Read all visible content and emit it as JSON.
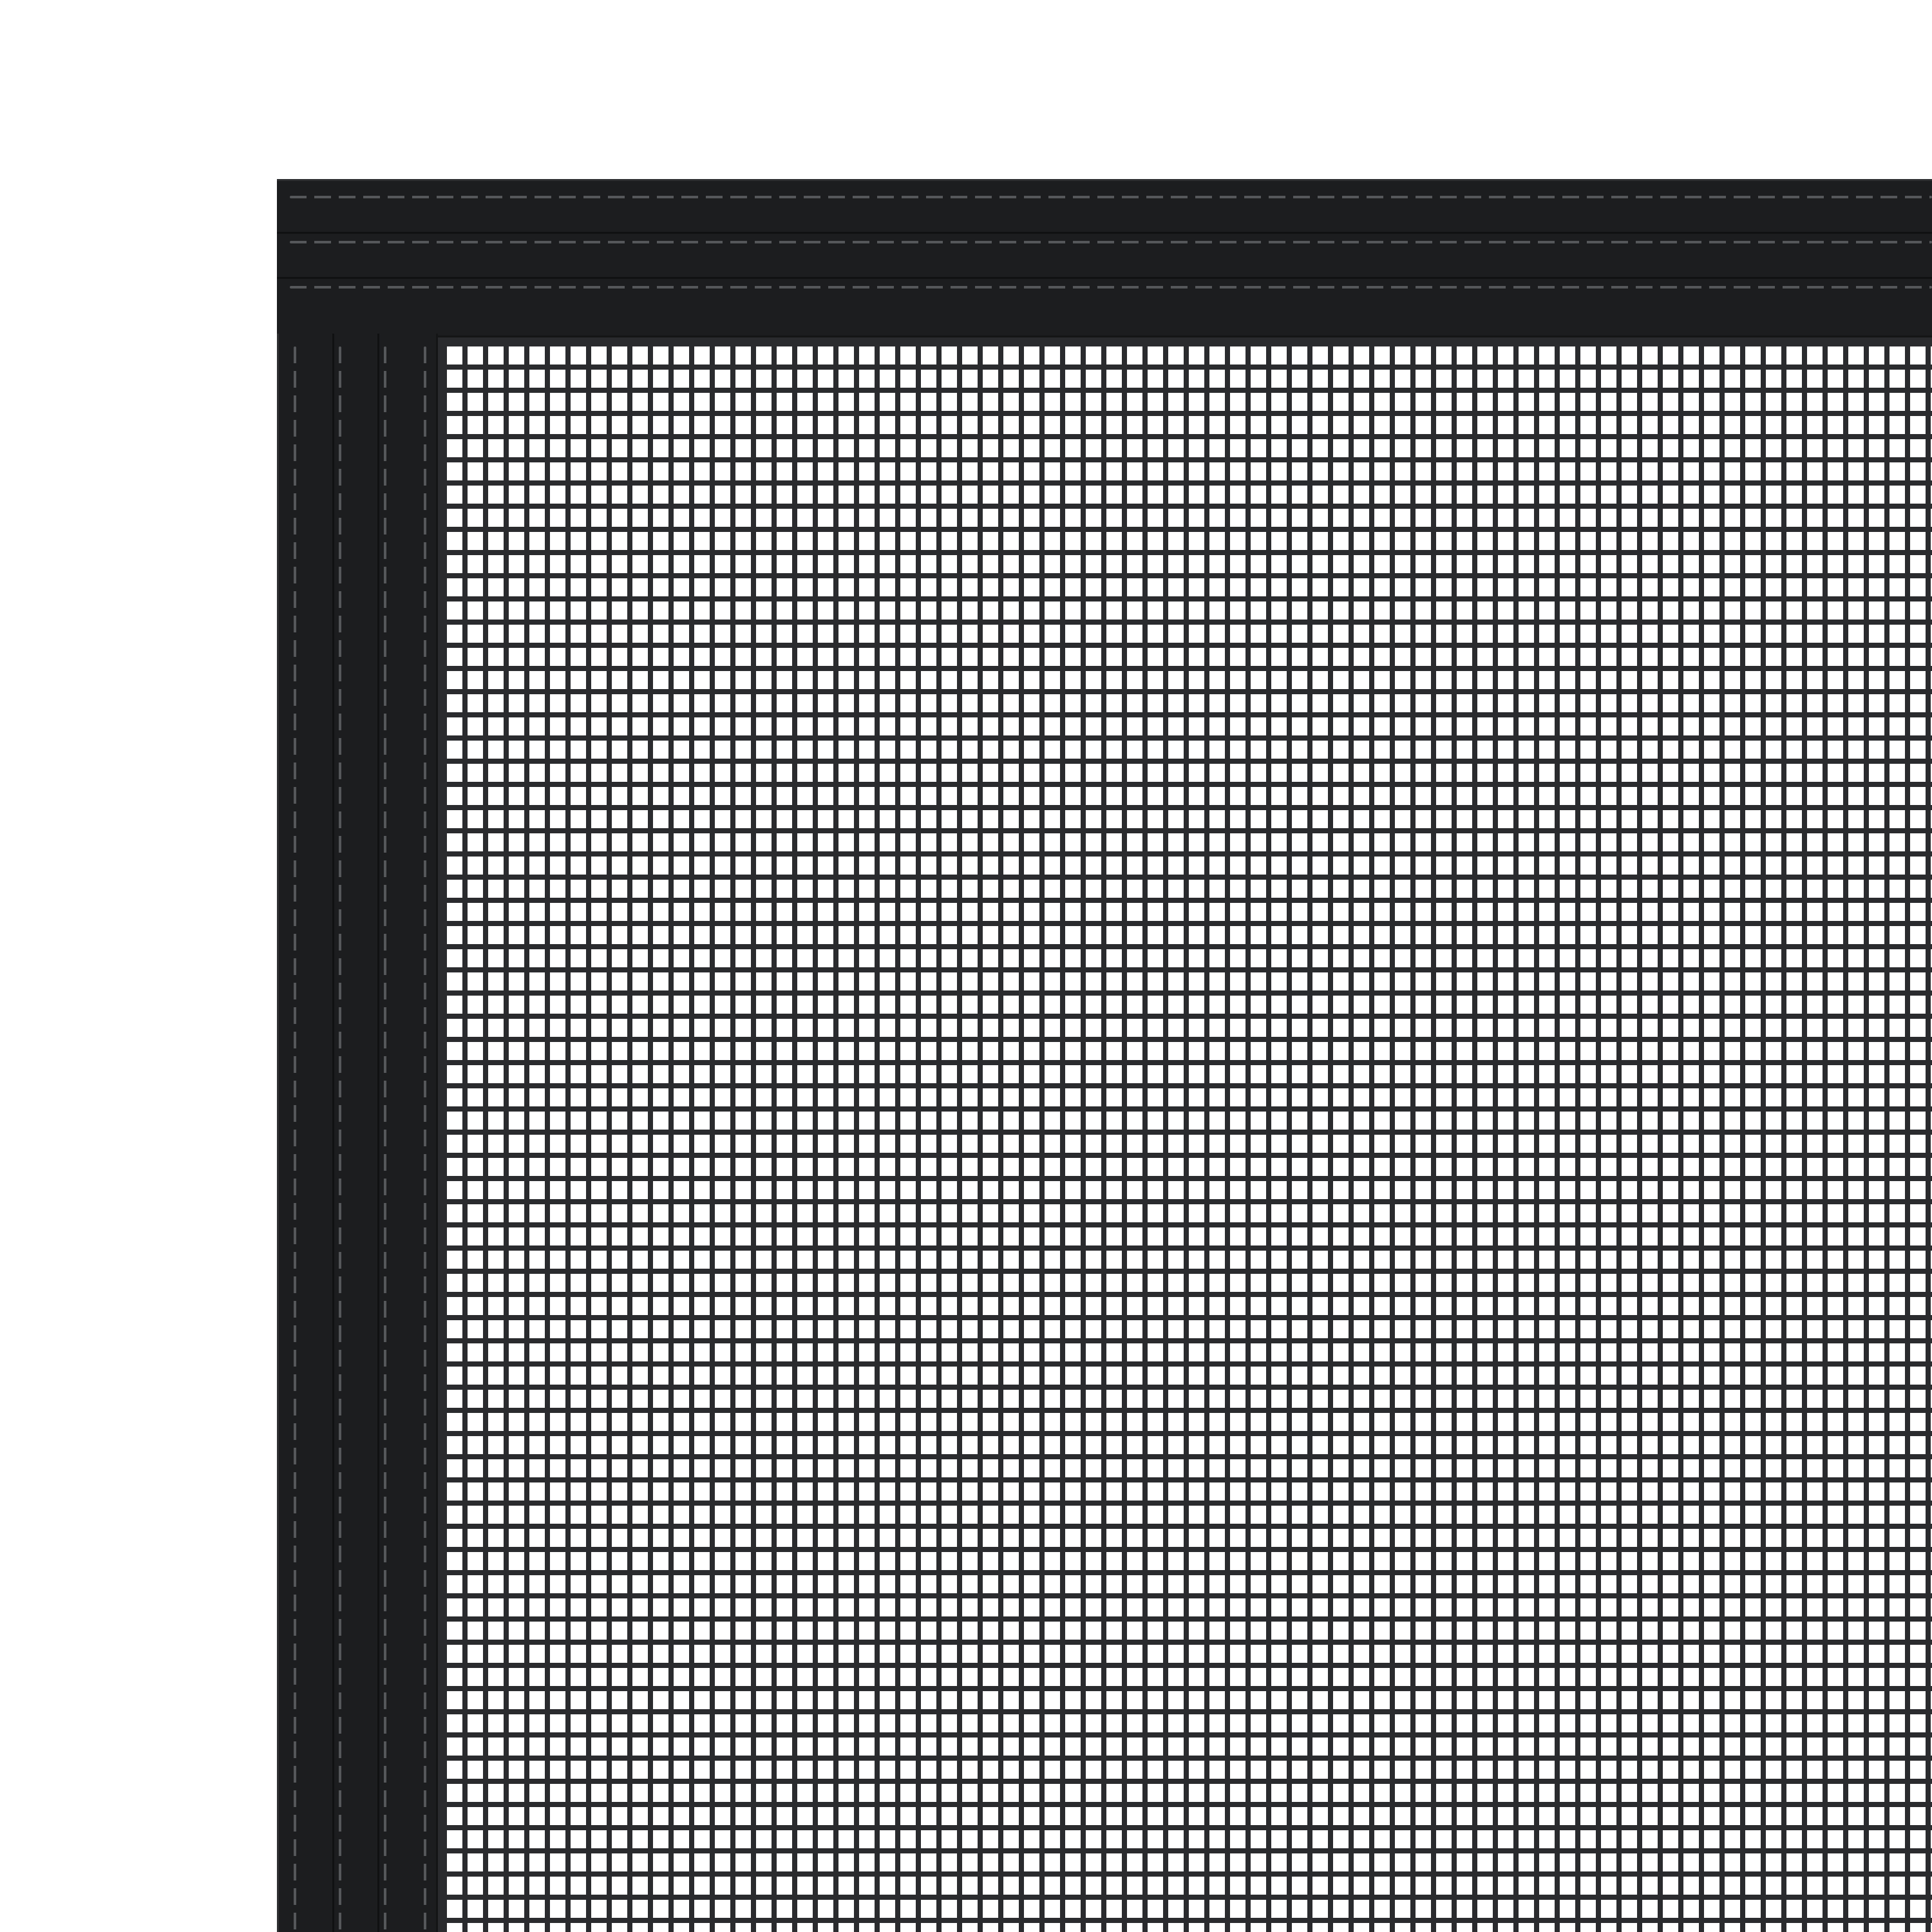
{
  "image": {
    "subject": "",
    "background_color": "#ffffff",
    "frame_color": "#1c1d1f",
    "mesh_color": "#2a2b2e",
    "stitch_color": "#55575a"
  }
}
